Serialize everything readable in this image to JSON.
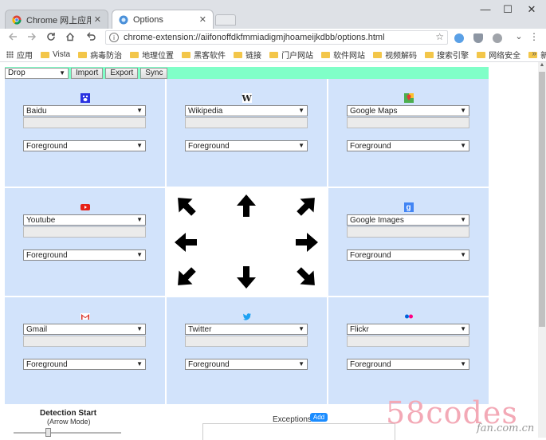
{
  "browser": {
    "tabs": [
      {
        "title": "Chrome 网上应用店 - I",
        "active": false
      },
      {
        "title": "Options",
        "active": true
      }
    ],
    "close_glyph": "✕",
    "window_controls": {
      "minimize": "—",
      "maximize": "☐",
      "close": "✕"
    },
    "url": "chrome-extension://aiifonoffdkfmmiadigmjhoameijkdbb/options.html",
    "nav_icons": [
      "back-icon",
      "forward-icon",
      "reload-icon",
      "home-icon",
      "undo-icon"
    ],
    "bookmarks": [
      {
        "label": "应用",
        "type": "apps"
      },
      {
        "label": "Vista",
        "type": "folder"
      },
      {
        "label": "病毒防治",
        "type": "folder"
      },
      {
        "label": "地理位置",
        "type": "folder"
      },
      {
        "label": "黑客软件",
        "type": "folder"
      },
      {
        "label": "链接",
        "type": "folder"
      },
      {
        "label": "门户网站",
        "type": "folder"
      },
      {
        "label": "软件网站",
        "type": "folder"
      },
      {
        "label": "视频解码",
        "type": "folder"
      },
      {
        "label": "搜索引擎",
        "type": "folder"
      },
      {
        "label": "网络安全",
        "type": "folder"
      },
      {
        "label": "新闻网站",
        "type": "folder"
      }
    ],
    "bookmarks_more": "»"
  },
  "toolbar": {
    "mode_select": "Drop",
    "import_label": "Import",
    "export_label": "Export",
    "sync_label": "Sync"
  },
  "cells": [
    {
      "engine": "Baidu",
      "icon": "baidu-icon",
      "mode": "Foreground"
    },
    {
      "engine": "Wikipedia",
      "icon": "wikipedia-icon",
      "mode": "Foreground"
    },
    {
      "engine": "Google Maps",
      "icon": "google-maps-icon",
      "mode": "Foreground"
    },
    {
      "engine": "Youtube",
      "icon": "youtube-icon",
      "mode": "Foreground"
    },
    {
      "engine": "Google Images",
      "icon": "google-images-icon",
      "mode": "Foreground"
    },
    {
      "engine": "Gmail",
      "icon": "gmail-icon",
      "mode": "Foreground"
    },
    {
      "engine": "Twitter",
      "icon": "twitter-icon",
      "mode": "Foreground"
    },
    {
      "engine": "Flickr",
      "icon": "flickr-icon",
      "mode": "Foreground"
    }
  ],
  "wikipedia_glyph": "W",
  "google_glyph": "g",
  "detection": {
    "title": "Detection Start",
    "subtitle": "(Arrow Mode)"
  },
  "exceptions": {
    "label": "Exceptions",
    "add_label": "Add"
  },
  "watermark": {
    "main": "58codes",
    "sub": "fan.com.cn"
  },
  "colors": {
    "topbar": "#80ffc8",
    "cell_bg": "#d2e3fb",
    "add_button": "#1a8cff"
  }
}
